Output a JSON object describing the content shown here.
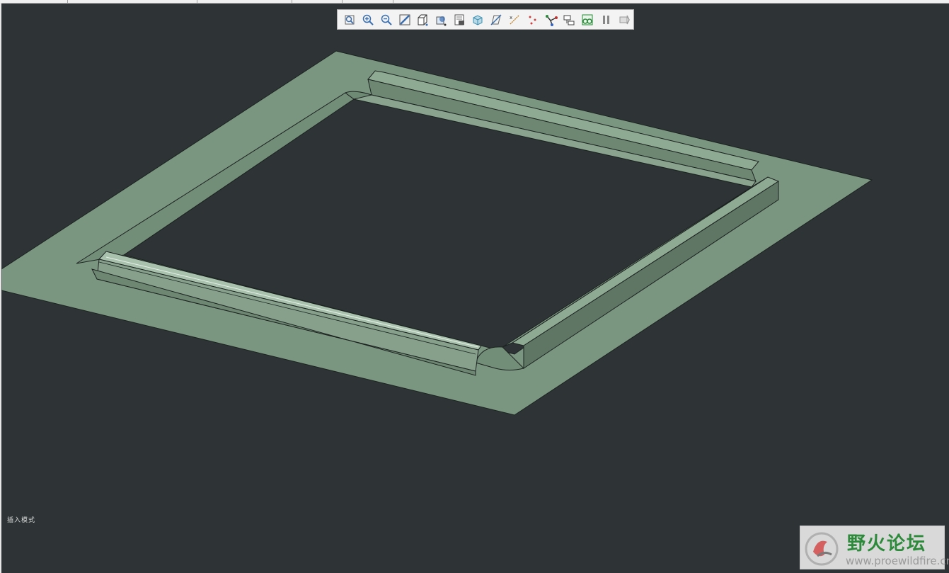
{
  "viewport": {
    "background": "#2e3436",
    "model_color": "#7b9680",
    "model_highlight": "#8eaa93",
    "model_shadow": "#5e7663"
  },
  "toolbar": {
    "buttons": [
      {
        "name": "refit-icon",
        "color": "#3a6fb0"
      },
      {
        "name": "zoom-in-icon",
        "color": "#3a6fb0"
      },
      {
        "name": "zoom-out-icon",
        "color": "#3a6fb0"
      },
      {
        "name": "repaint-icon",
        "color": "#3a6fb0"
      },
      {
        "name": "display-style-icon",
        "color": "#3a6fb0"
      },
      {
        "name": "saved-orientations-icon",
        "color": "#3a6fb0"
      },
      {
        "name": "view-manager-icon",
        "color": "#555555"
      },
      {
        "name": "perspective-view-icon",
        "color": "#3a8fb0"
      },
      {
        "name": "datum-plane-display-icon",
        "color": "#3a6fb0"
      },
      {
        "name": "datum-axis-display-icon",
        "color": "#c08020"
      },
      {
        "name": "datum-point-display-icon",
        "color": "#d04040"
      },
      {
        "name": "coordinate-system-display-icon",
        "color": "#2a8a3a"
      },
      {
        "name": "annotation-display-icon",
        "color": "#555555"
      },
      {
        "name": "spin-center-icon",
        "color": "#2a8a3a"
      },
      {
        "name": "pause-icon",
        "color": "#888888"
      },
      {
        "name": "next-icon",
        "color": "#999999"
      }
    ]
  },
  "status": {
    "mode_text": "插入模式"
  },
  "watermark": {
    "title": "野火论坛",
    "url": "www.proewildfire.cn"
  }
}
